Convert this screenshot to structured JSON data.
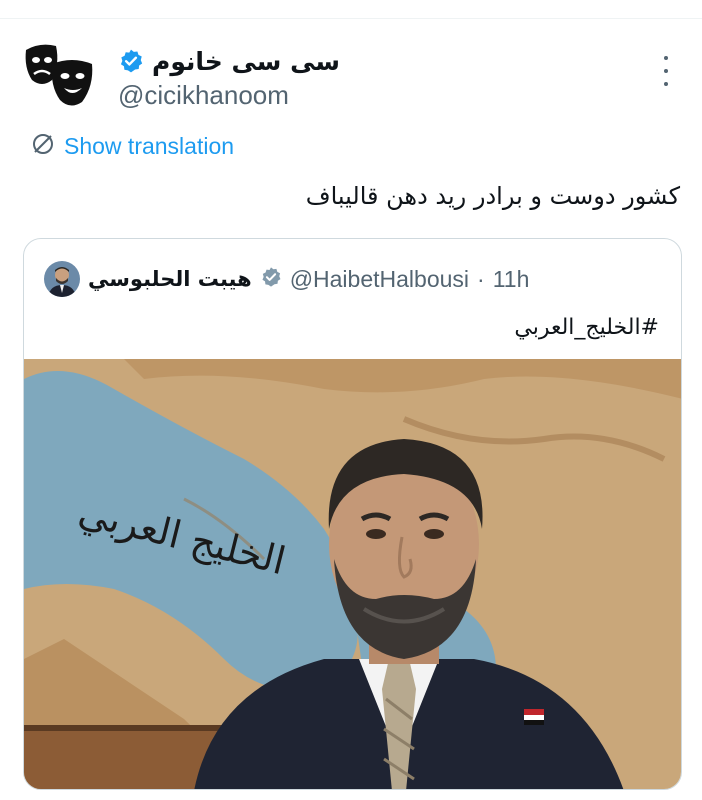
{
  "tweet": {
    "author": {
      "display_name": "سی سی خانوم",
      "handle": "@cicikhanoom",
      "verified_icon": "verified-badge-icon",
      "avatar_icon": "theater-masks-icon"
    },
    "more_icon": "more-options-icon",
    "translation": {
      "icon": "translate-icon",
      "label": "Show translation"
    },
    "text": "کشور دوست و برادر رید دهن قالیباف"
  },
  "quoted_tweet": {
    "author": {
      "display_name": "هيبت الحلبوسي",
      "handle": "@HaibetHalbousi",
      "separator": "·",
      "time": "11h",
      "verified_icon": "gray-verified-badge-icon"
    },
    "text": "#الخليج_العربي",
    "image": {
      "overlay_text": "الخليج العربي",
      "description_icon": "gulf-map-portrait-image"
    }
  },
  "colors": {
    "accent": "#1d9bf0",
    "secondary_text": "#536471",
    "border": "#cfd9de"
  }
}
